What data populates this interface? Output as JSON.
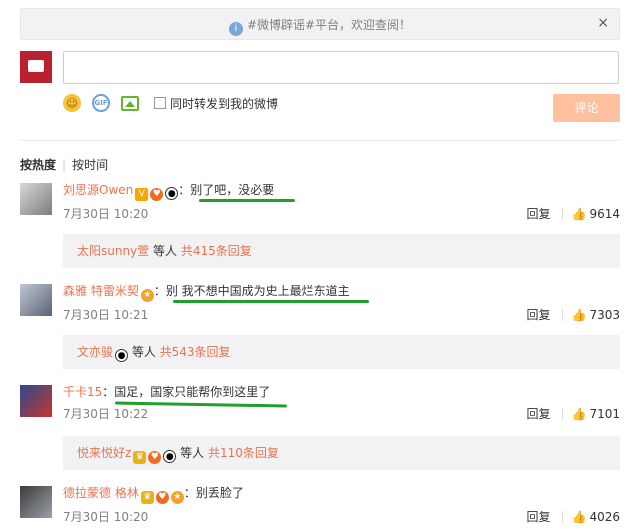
{
  "notice": {
    "text": "#微博辟谣#平台，欢迎查阅！",
    "close": "×"
  },
  "composer": {
    "forward_label": "同时转发到我的微博",
    "submit_label": "评论"
  },
  "sort": {
    "hot": "按热度",
    "time": "按时间"
  },
  "comments": [
    {
      "user": "刘思源Owen",
      "text": "：别了吧，没必要",
      "time": "7月30日 10:20",
      "reply": "回复",
      "likes": "9614",
      "sub": {
        "user": "太阳sunny萱",
        "mid": " 等人 ",
        "more": "共415条回复"
      }
    },
    {
      "user": "森雅 特雷米契",
      "text": "：别 我不想中国成为史上最烂东道主",
      "time": "7月30日 10:21",
      "reply": "回复",
      "likes": "7303",
      "sub": {
        "user": "文亦骏",
        "mid": " 等人 ",
        "more": "共543条回复"
      }
    },
    {
      "user": "千卡15",
      "text": "：国足，国家只能帮你到这里了",
      "time": "7月30日 10:22",
      "reply": "回复",
      "likes": "7101",
      "sub": {
        "user": "悦来悦好z",
        "mid": " 等人 ",
        "more": "共110条回复"
      }
    },
    {
      "user": "德拉蒙德 格林",
      "text": "：别丢脸了",
      "time": "7月30日 10:20",
      "reply": "回复",
      "likes": "4026"
    }
  ],
  "colors": {
    "accent": "#eb7350",
    "underline": "#1fa02c",
    "submit": "#ffc09f"
  }
}
